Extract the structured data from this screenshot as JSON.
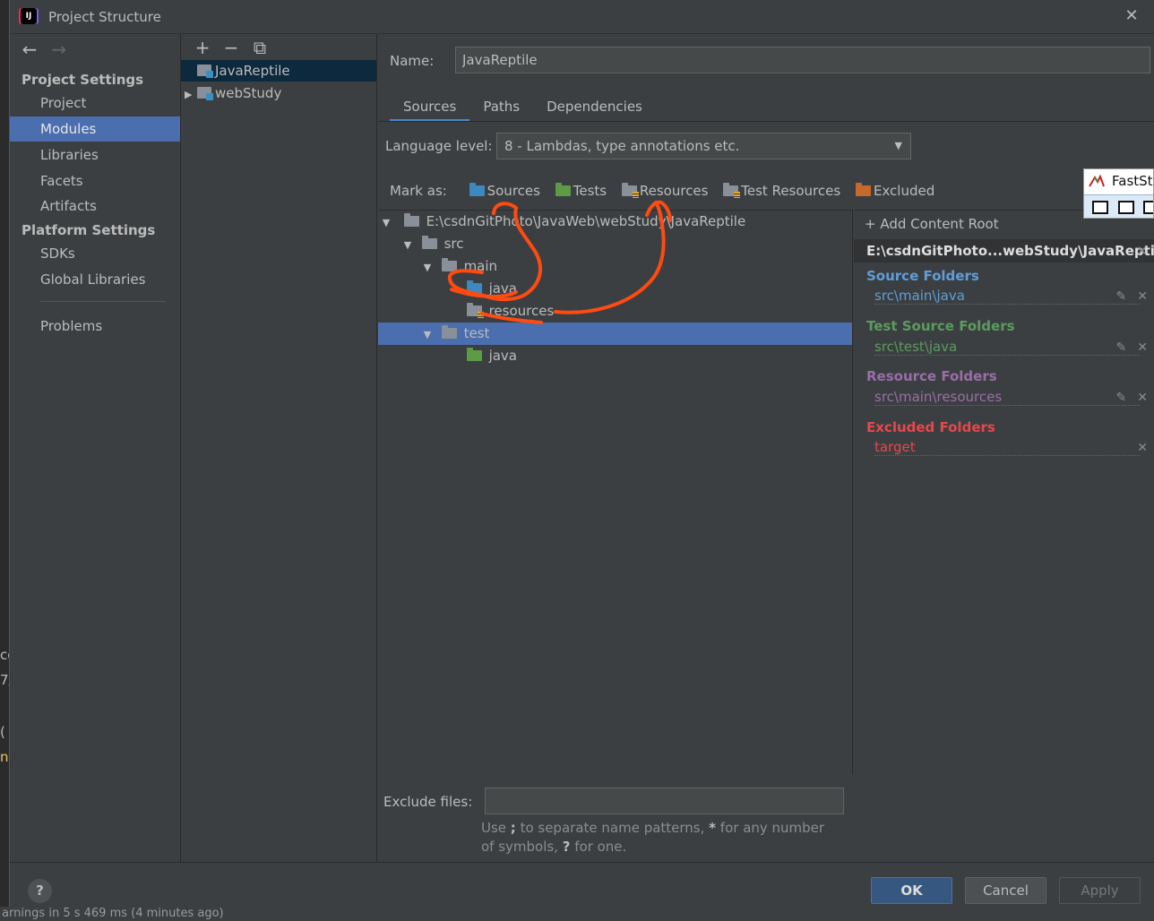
{
  "window": {
    "title": "Project Structure"
  },
  "nav": {
    "project_settings": "Project Settings",
    "platform_settings": "Platform Settings",
    "items": [
      {
        "label": "Project"
      },
      {
        "label": "Modules"
      },
      {
        "label": "Libraries"
      },
      {
        "label": "Facets"
      },
      {
        "label": "Artifacts"
      },
      {
        "label": "SDKs"
      },
      {
        "label": "Global Libraries"
      },
      {
        "label": "Problems"
      }
    ],
    "selected": "Modules"
  },
  "modules": [
    {
      "name": "JavaReptile",
      "selected": true
    },
    {
      "name": "webStudy",
      "selected": false
    }
  ],
  "module": {
    "name_label": "Name:",
    "name_value": "JavaReptile",
    "tabs": [
      "Sources",
      "Paths",
      "Dependencies"
    ],
    "active_tab": "Sources",
    "language_label": "Language level:",
    "language_value": "8 - Lambdas, type annotations etc.",
    "mark_as_label": "Mark as:",
    "mark_as": [
      "Sources",
      "Tests",
      "Resources",
      "Test Resources",
      "Excluded"
    ]
  },
  "tree": [
    {
      "label": "E:\\csdnGitPhoto\\JavaWeb\\webStudy\\JavaReptile"
    },
    {
      "label": "src"
    },
    {
      "label": "main"
    },
    {
      "label": "java"
    },
    {
      "label": "resources"
    },
    {
      "label": "test",
      "selected": true
    },
    {
      "label": "java"
    }
  ],
  "roots": {
    "add_label": "Add Content Root",
    "header": "E:\\csdnGitPhoto...webStudy\\JavaReptile",
    "source_title": "Source Folders",
    "source_path": "src\\main\\java",
    "test_title": "Test Source Folders",
    "test_path": "src\\test\\java",
    "resource_title": "Resource Folders",
    "resource_path": "src\\main\\resources",
    "excluded_title": "Excluded Folders",
    "excluded_path": "target"
  },
  "colors": {
    "source": "#5f9ed9",
    "test": "#5b9b5f",
    "resource": "#9a6ea8",
    "excluded": "#e5484d"
  },
  "exclude": {
    "label": "Exclude files:",
    "hint_a": "Use ",
    "hint_b": ";",
    "hint_c": " to separate name patterns, ",
    "hint_d": "*",
    "hint_e": " for any number of symbols, ",
    "hint_f": "?",
    "hint_g": " for one."
  },
  "buttons": {
    "help": "?",
    "ok": "OK",
    "cancel": "Cancel",
    "apply": "Apply"
  },
  "overlay": {
    "fs_title": "FastSt"
  },
  "background": {
    "frag_1": "co",
    "frag_2": "7/",
    "frag_3": "(",
    "frag_4": "n",
    "bottom": "arnings in 5 s 469 ms (4 minutes ago)"
  }
}
